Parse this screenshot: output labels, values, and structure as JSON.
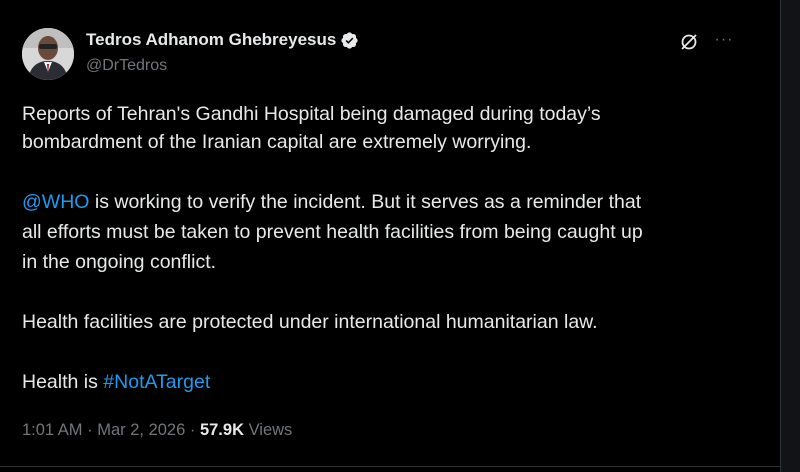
{
  "author": {
    "name": "Tedros Adhanom Ghebreyesus",
    "handle": "@DrTedros",
    "verified": true,
    "avatar_icon": "profile-photo"
  },
  "actions": {
    "grok_icon": "grok-icon",
    "more_icon": "more-icon",
    "more_label": "···"
  },
  "post": {
    "p1_l1": "Reports of Tehran's Gandhi Hospital being damaged during today’s",
    "p1_l2": "bombardment of the Iranian capital are extremely worrying.",
    "p2_mention": "@WHO",
    "p2_l1_rest": " is working to verify the incident. But it serves as a reminder that",
    "p2_l2": "all efforts must be taken to prevent health facilities from being caught up",
    "p2_l3": "in the ongoing conflict.",
    "p3": "Health facilities are protected under international humanitarian law.",
    "p4_prefix": "Health is ",
    "p4_hashtag": "#NotATarget"
  },
  "meta": {
    "time": "1:01 AM",
    "sep1": " · ",
    "date": "Mar 2, 2026",
    "sep2": " · ",
    "views_count": "57.9K",
    "views_label": " Views"
  },
  "colors": {
    "background": "#000000",
    "text": "#e7e9ea",
    "secondary": "#71767b",
    "link": "#1d9bf0"
  }
}
